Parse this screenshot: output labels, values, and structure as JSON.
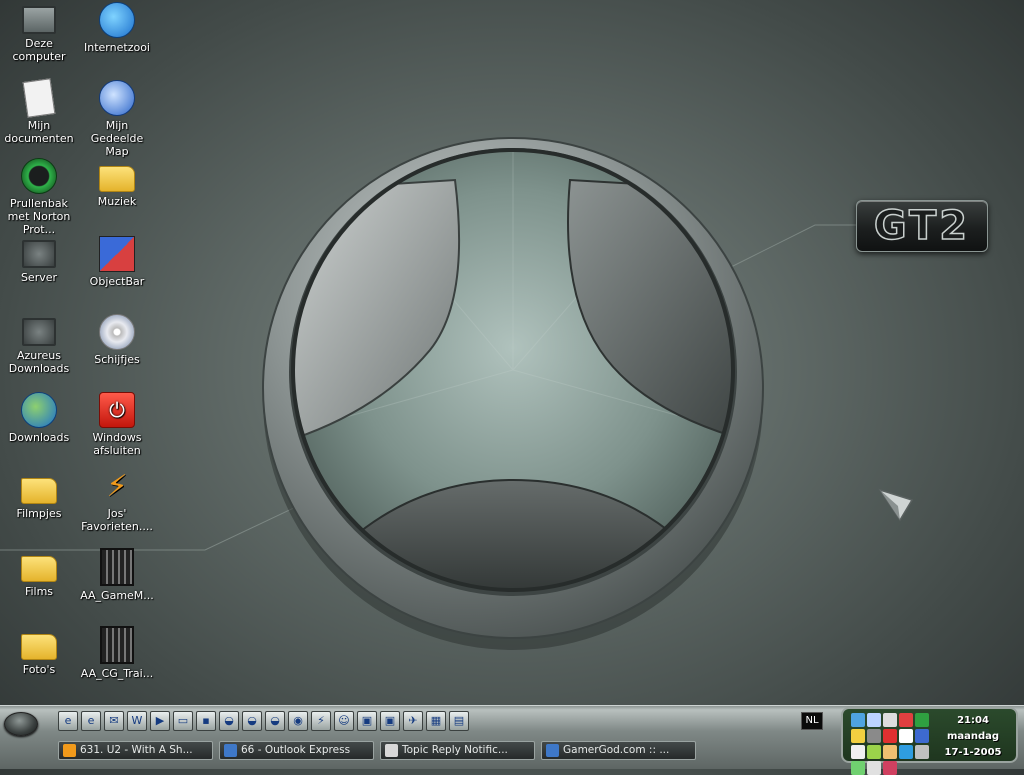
{
  "desktop": {
    "icons": [
      {
        "label": "Deze computer",
        "icon": "computer-icon"
      },
      {
        "label": "Internetzooi",
        "icon": "internet-globe-icon"
      },
      {
        "label": "Mijn documenten",
        "icon": "documents-icon"
      },
      {
        "label": "Mijn Gedeelde Map",
        "icon": "shared-folder-icon"
      },
      {
        "label": "Prullenbak met Norton Prot...",
        "icon": "recycle-bin-icon"
      },
      {
        "label": "Muziek",
        "icon": "music-folder-icon"
      },
      {
        "label": "Server",
        "icon": "server-icon"
      },
      {
        "label": "ObjectBar",
        "icon": "objectbar-icon"
      },
      {
        "label": "Azureus Downloads",
        "icon": "azureus-icon"
      },
      {
        "label": "Schijfjes",
        "icon": "disc-icon"
      },
      {
        "label": "Downloads",
        "icon": "downloads-globe-icon"
      },
      {
        "label": "Windows afsluiten",
        "icon": "shutdown-icon"
      },
      {
        "label": "Filmpjes",
        "icon": "video-folder-icon"
      },
      {
        "label": "Jos' Favorieten....",
        "icon": "winamp-icon"
      },
      {
        "label": "Films",
        "icon": "films-folder-icon"
      },
      {
        "label": "AA_GameM...",
        "icon": "film-strip-icon"
      },
      {
        "label": "Foto's",
        "icon": "photos-folder-icon"
      },
      {
        "label": "AA_CG_Trai...",
        "icon": "film-strip-icon"
      }
    ]
  },
  "wallpaper": {
    "badge_text": "GT2"
  },
  "taskbar": {
    "quicklaunch": [
      {
        "icon": "ie-icon",
        "glyph": "e"
      },
      {
        "icon": "ie-icon",
        "glyph": "e"
      },
      {
        "icon": "outlook-icon",
        "glyph": "✉"
      },
      {
        "icon": "word-icon",
        "glyph": "W"
      },
      {
        "icon": "media-player-icon",
        "glyph": "▶"
      },
      {
        "icon": "display-icon",
        "glyph": "▭"
      },
      {
        "icon": "floppy-icon",
        "glyph": "▪"
      },
      {
        "icon": "drive-icon",
        "glyph": "◒"
      },
      {
        "icon": "drive-icon",
        "glyph": "◒"
      },
      {
        "icon": "drive-icon",
        "glyph": "◒"
      },
      {
        "icon": "browser-icon",
        "glyph": "◉"
      },
      {
        "icon": "winamp-icon",
        "glyph": "⚡"
      },
      {
        "icon": "robot-icon",
        "glyph": "☺"
      },
      {
        "icon": "app-icon",
        "glyph": "▣"
      },
      {
        "icon": "app-icon",
        "glyph": "▣"
      },
      {
        "icon": "app-icon",
        "glyph": "✈"
      },
      {
        "icon": "calculator-icon",
        "glyph": "▦"
      },
      {
        "icon": "app-icon",
        "glyph": "▤"
      }
    ],
    "tasks": [
      {
        "label": "631. U2 - With A Sh...",
        "icon": "winamp-icon",
        "color": "#f19a1b"
      },
      {
        "label": "66 - Outlook Express",
        "icon": "outlook-icon",
        "color": "#3e78c8"
      },
      {
        "label": "Topic Reply Notific...",
        "icon": "mail-icon",
        "color": "#d8d8d8"
      },
      {
        "label": "GamerGod.com :: ...",
        "icon": "ie-icon",
        "color": "#3e78c8"
      }
    ],
    "language": "NL",
    "clock": {
      "time": "21:04",
      "day": "maandag",
      "date": "17-1-2005"
    },
    "tray_colors": [
      "#4fa3e0",
      "#bcd4ff",
      "#dddddd",
      "#e04040",
      "#2fa040",
      "#f2d040",
      "#8a8a8a",
      "#e03030",
      "#ffffff",
      "#3d6ad0",
      "#f0f0f0",
      "#9bd34a",
      "#f0c070",
      "#2f9de0",
      "#c0c0c0",
      "#70d070",
      "#e0e0e0",
      "#d04060"
    ]
  }
}
